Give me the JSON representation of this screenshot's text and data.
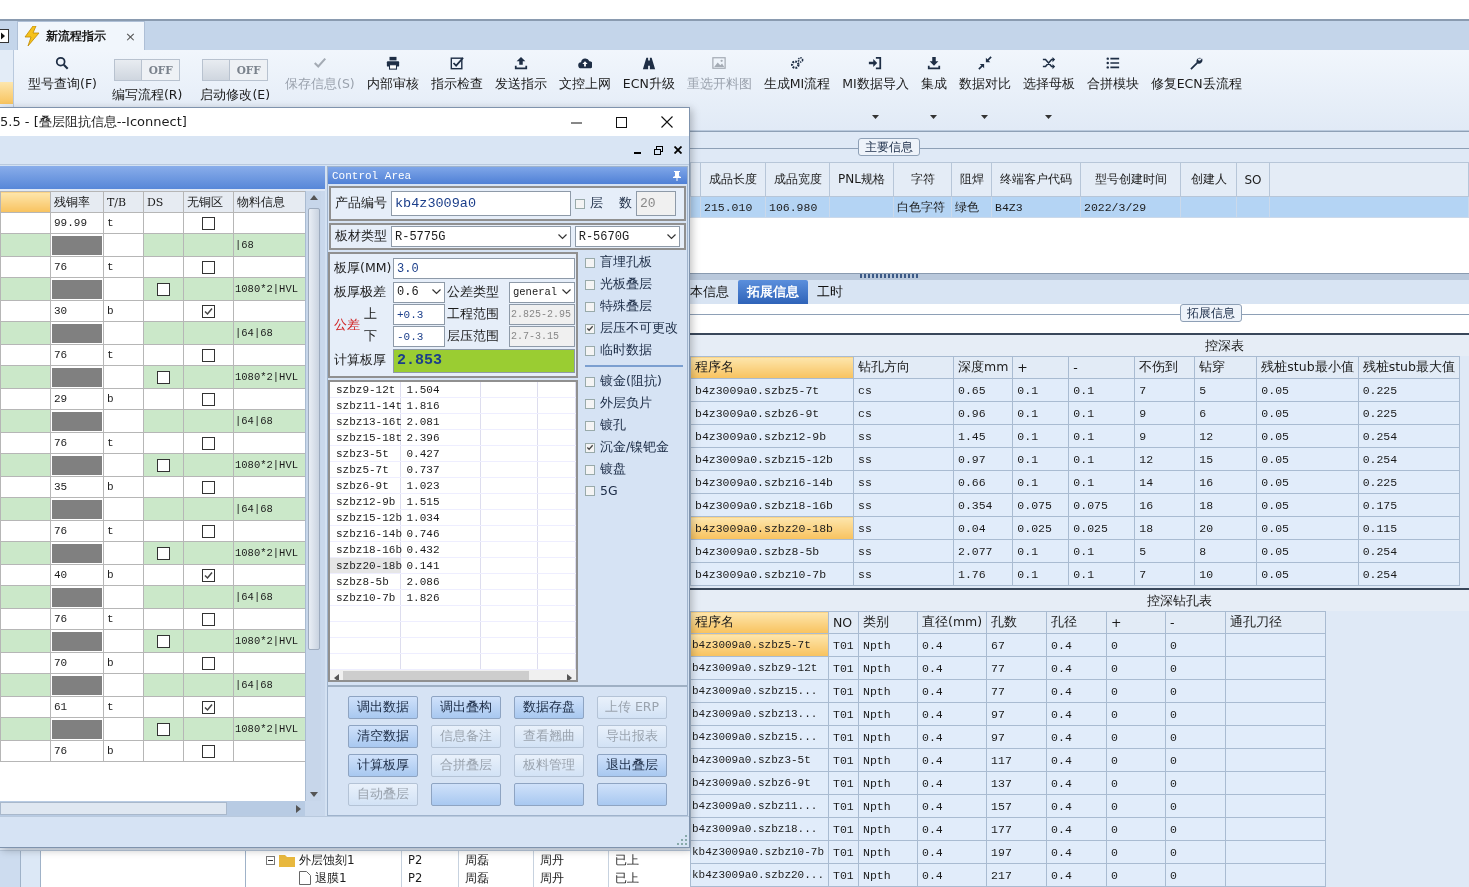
{
  "app": {
    "tab": {
      "title": "新流程指示",
      "close": "×"
    },
    "ribbon": [
      {
        "kind": "button",
        "label": "型号查询(F)",
        "disabled": false
      },
      {
        "kind": "toggle",
        "label": "编写流程(R)",
        "state": "OFF",
        "on": false
      },
      {
        "kind": "toggle",
        "label": "启动修改(E)",
        "state": "OFF",
        "on": false
      },
      {
        "kind": "button",
        "label": "保存信息(S)",
        "disabled": true
      },
      {
        "kind": "button",
        "label": "内部审核",
        "disabled": false
      },
      {
        "kind": "button",
        "label": "指示检查",
        "disabled": false
      },
      {
        "kind": "button",
        "label": "发送指示",
        "disabled": false
      },
      {
        "kind": "button",
        "label": "文控上网",
        "disabled": false
      },
      {
        "kind": "button",
        "label": "ECN升级",
        "disabled": false
      },
      {
        "kind": "button",
        "label": "重选开料图",
        "disabled": true
      },
      {
        "kind": "button",
        "label": "生成MI流程",
        "disabled": false
      },
      {
        "kind": "button",
        "label": "MI数据导入",
        "disabled": false,
        "has_menu": true
      },
      {
        "kind": "button",
        "label": "集成",
        "disabled": false,
        "has_menu": true
      },
      {
        "kind": "button",
        "label": "数据对比",
        "disabled": false,
        "has_menu": true
      },
      {
        "kind": "button",
        "label": "选择母板",
        "disabled": false,
        "has_menu": true
      },
      {
        "kind": "button",
        "label": "合拼模块",
        "disabled": false
      },
      {
        "kind": "button",
        "label": "修复ECN丢流程",
        "disabled": false
      }
    ],
    "main_info": {
      "group": "主要信息",
      "columns": [
        "成品长度",
        "成品宽度",
        "PNL规格",
        "字符",
        "阻焊",
        "终端客户代码",
        "型号创建时间",
        "创建人",
        "SO"
      ],
      "rows": [
        {
          "selected": true,
          "cells": [
            "215.010",
            "106.980",
            null,
            "白色字符",
            "绿色",
            "B4Z3",
            "2022/3/29",
            null,
            null
          ]
        }
      ]
    },
    "detail_tabs": [
      {
        "label": "本信息",
        "selected": false
      },
      {
        "label": "拓展信息",
        "selected": true
      },
      {
        "label": "工时",
        "selected": false
      }
    ],
    "detail_group": "拓展信息",
    "depth_table": {
      "title": "控深表",
      "columns": [
        "程序名",
        "钻孔方向",
        "深度mm",
        "+",
        "-",
        "不伤到",
        "钻穿",
        "残桩stub最小值",
        "残桩stub最大值"
      ],
      "rows": [
        {
          "selected": false,
          "cells": [
            "b4z3009a0.szbz5-7t",
            "cs",
            "0.65",
            "0.1",
            "0.1",
            "7",
            "5",
            "0.05",
            "0.225"
          ]
        },
        {
          "selected": false,
          "cells": [
            "b4z3009a0.szbz6-9t",
            "cs",
            "0.96",
            "0.1",
            "0.1",
            "9",
            "6",
            "0.05",
            "0.225"
          ]
        },
        {
          "selected": false,
          "cells": [
            "b4z3009a0.szbz12-9b",
            "ss",
            "1.45",
            "0.1",
            "0.1",
            "9",
            "12",
            "0.05",
            "0.254"
          ]
        },
        {
          "selected": false,
          "cells": [
            "b4z3009a0.szbz15-12b",
            "ss",
            "0.97",
            "0.1",
            "0.1",
            "12",
            "15",
            "0.05",
            "0.254"
          ]
        },
        {
          "selected": false,
          "cells": [
            "b4z3009a0.szbz16-14b",
            "ss",
            "0.66",
            "0.1",
            "0.1",
            "14",
            "16",
            "0.05",
            "0.225"
          ]
        },
        {
          "selected": false,
          "cells": [
            "b4z3009a0.szbz18-16b",
            "ss",
            "0.354",
            "0.075",
            "0.075",
            "16",
            "18",
            "0.05",
            "0.175"
          ]
        },
        {
          "selected": true,
          "cells": [
            "b4z3009a0.szbz20-18b",
            "ss",
            "0.04",
            "0.025",
            "0.025",
            "18",
            "20",
            "0.05",
            "0.115"
          ]
        },
        {
          "selected": false,
          "cells": [
            "b4z3009a0.szbz8-5b",
            "ss",
            "2.077",
            "0.1",
            "0.1",
            "5",
            "8",
            "0.05",
            "0.254"
          ]
        },
        {
          "selected": false,
          "cells": [
            "b4z3009a0.szbz10-7b",
            "ss",
            "1.76",
            "0.1",
            "0.1",
            "7",
            "10",
            "0.05",
            "0.254"
          ]
        }
      ]
    },
    "drill_table": {
      "title": "控深钻孔表",
      "columns": [
        "程序名",
        "NO",
        "类别",
        "直径(mm)",
        "孔数",
        "孔径",
        "+",
        "-",
        "通孔刀径"
      ],
      "rows": [
        {
          "selected": true,
          "cells": [
            "b4z3009a0.szbz5-7t",
            "T01",
            "Npth",
            "0.4",
            "67",
            "0.4",
            "0",
            "0",
            null
          ]
        },
        {
          "selected": false,
          "cells": [
            "b4z3009a0.szbz9-12t",
            "T01",
            "Npth",
            "0.4",
            "77",
            "0.4",
            "0",
            "0",
            null
          ]
        },
        {
          "selected": false,
          "cells": [
            "b4z3009a0.szbz15...",
            "T01",
            "Npth",
            "0.4",
            "77",
            "0.4",
            "0",
            "0",
            null
          ]
        },
        {
          "selected": false,
          "cells": [
            "b4z3009a0.szbz13...",
            "T01",
            "Npth",
            "0.4",
            "97",
            "0.4",
            "0",
            "0",
            null
          ]
        },
        {
          "selected": false,
          "cells": [
            "b4z3009a0.szbz15...",
            "T01",
            "Npth",
            "0.4",
            "97",
            "0.4",
            "0",
            "0",
            null
          ]
        },
        {
          "selected": false,
          "cells": [
            "b4z3009a0.szbz3-5t",
            "T01",
            "Npth",
            "0.4",
            "117",
            "0.4",
            "0",
            "0",
            null
          ]
        },
        {
          "selected": false,
          "cells": [
            "b4z3009a0.szbz6-9t",
            "T01",
            "Npth",
            "0.4",
            "137",
            "0.4",
            "0",
            "0",
            null
          ]
        },
        {
          "selected": false,
          "cells": [
            "b4z3009a0.szbz11...",
            "T01",
            "Npth",
            "0.4",
            "157",
            "0.4",
            "0",
            "0",
            null
          ]
        },
        {
          "selected": false,
          "cells": [
            "b4z3009a0.szbz18...",
            "T01",
            "Npth",
            "0.4",
            "177",
            "0.4",
            "0",
            "0",
            null
          ]
        },
        {
          "selected": false,
          "cells": [
            "kb4z3009a0.szbz10-7b",
            "T01",
            "Npth",
            "0.4",
            "197",
            "0.4",
            "0",
            "0",
            null
          ]
        },
        {
          "selected": false,
          "cells": [
            "kb4z3009a0.szbz20...",
            "T01",
            "Npth",
            "0.4",
            "217",
            "0.4",
            "0",
            "0",
            null
          ]
        }
      ]
    },
    "tree": [
      {
        "kind": "folder",
        "expanded": true,
        "name": "外层蚀刻1",
        "cells": [
          "P2",
          "周磊",
          "周丹",
          "已上"
        ]
      },
      {
        "kind": "file",
        "name": "退膜1",
        "cells": [
          "P2",
          "周磊",
          "周丹",
          "已上"
        ]
      }
    ]
  },
  "dialog": {
    "title": "5.5 - [叠层阻抗信息--Iconnect]",
    "stack_grid": {
      "columns": [
        "残铜率",
        "T/B",
        "DS",
        "无铜区",
        "物料信息"
      ],
      "rows": [
        {
          "kind": "copper",
          "residual": "99.99",
          "tb": "t",
          "no_copper": false
        },
        {
          "kind": "prepreg",
          "material": "|68"
        },
        {
          "kind": "copper",
          "residual": "76",
          "tb": "t",
          "no_copper": false
        },
        {
          "kind": "prepreg",
          "ds": false,
          "material": "1080*2|HVL"
        },
        {
          "kind": "copper",
          "residual": "30",
          "tb": "b",
          "no_copper": true
        },
        {
          "kind": "prepreg",
          "material": "|64|68"
        },
        {
          "kind": "copper",
          "residual": "76",
          "tb": "t",
          "no_copper": false
        },
        {
          "kind": "prepreg",
          "ds": false,
          "material": "1080*2|HVL"
        },
        {
          "kind": "copper",
          "residual": "29",
          "tb": "b",
          "no_copper": false
        },
        {
          "kind": "prepreg",
          "material": "|64|68"
        },
        {
          "kind": "copper",
          "residual": "76",
          "tb": "t",
          "no_copper": false
        },
        {
          "kind": "prepreg",
          "ds": false,
          "material": "1080*2|HVL"
        },
        {
          "kind": "copper",
          "residual": "35",
          "tb": "b",
          "no_copper": false
        },
        {
          "kind": "prepreg",
          "material": "|64|68"
        },
        {
          "kind": "copper",
          "residual": "76",
          "tb": "t",
          "no_copper": false
        },
        {
          "kind": "prepreg",
          "ds": false,
          "material": "1080*2|HVL"
        },
        {
          "kind": "copper",
          "residual": "40",
          "tb": "b",
          "no_copper": true
        },
        {
          "kind": "prepreg",
          "material": "|64|68"
        },
        {
          "kind": "copper",
          "residual": "76",
          "tb": "t",
          "no_copper": false
        },
        {
          "kind": "prepreg",
          "ds": false,
          "material": "1080*2|HVL"
        },
        {
          "kind": "copper",
          "residual": "70",
          "tb": "b",
          "no_copper": false
        },
        {
          "kind": "prepreg",
          "material": "|64|68"
        },
        {
          "kind": "copper",
          "residual": "61",
          "tb": "t",
          "no_copper": true
        },
        {
          "kind": "prepreg",
          "ds": false,
          "material": "1080*2|HVL"
        },
        {
          "kind": "copper",
          "residual": "76",
          "tb": "b",
          "no_copper": false
        }
      ]
    },
    "control_area": {
      "title": "Control Area",
      "product": {
        "label": "产品编号",
        "value": "kb4z3009a0"
      },
      "layers": {
        "label": "层 数",
        "checked": false,
        "value": "20"
      },
      "material": {
        "label": "板材类型",
        "core": "R-5775G",
        "prepreg": "R-5670G"
      },
      "thickness": {
        "label": "板厚(MM)",
        "value": "3.0"
      },
      "range": {
        "label": "板厚极差",
        "value": "0.6"
      },
      "tolerance_type": {
        "label": "公差类型",
        "value": "general"
      },
      "tolerance": {
        "label": "公差",
        "upper_label": "上",
        "upper": "+0.3",
        "lower_label": "下",
        "lower": "-0.3"
      },
      "eng_range": {
        "label": "工程范围",
        "value": "2.825-2.95"
      },
      "press_range": {
        "label": "层压范围",
        "value": "2.7-3.15"
      },
      "calc": {
        "label": "计算板厚",
        "value": "2.853"
      },
      "options": [
        {
          "label": "盲埋孔板",
          "checked": false
        },
        {
          "label": "光板叠层",
          "checked": false
        },
        {
          "label": "特殊叠层",
          "checked": false
        },
        {
          "label": "层压不可更改",
          "checked": true
        },
        {
          "label": "临时数据",
          "checked": false
        }
      ],
      "options_2": [
        {
          "label": "镀金(阻抗)",
          "checked": false
        },
        {
          "label": "外层负片",
          "checked": false
        },
        {
          "label": "镀孔",
          "checked": false
        },
        {
          "label": "沉金/镍钯金",
          "checked": true
        },
        {
          "label": "镀盘",
          "checked": false
        },
        {
          "label": "5G",
          "checked": false
        }
      ],
      "layer_list": [
        {
          "name": "szbz9-12t",
          "value": "1.504",
          "selected": false
        },
        {
          "name": "szbz11-14t",
          "value": "1.816",
          "selected": false
        },
        {
          "name": "szbz13-16t",
          "value": "2.081",
          "selected": false
        },
        {
          "name": "szbz15-18t",
          "value": "2.396",
          "selected": false
        },
        {
          "name": "szbz3-5t",
          "value": "0.427",
          "selected": false
        },
        {
          "name": "szbz5-7t",
          "value": "0.737",
          "selected": false
        },
        {
          "name": "szbz6-9t",
          "value": "1.023",
          "selected": false
        },
        {
          "name": "szbz12-9b",
          "value": "1.515",
          "selected": false
        },
        {
          "name": "szbz15-12b",
          "value": "1.034",
          "selected": false
        },
        {
          "name": "szbz16-14b",
          "value": "0.746",
          "selected": false
        },
        {
          "name": "szbz18-16b",
          "value": "0.432",
          "selected": false
        },
        {
          "name": "szbz20-18b",
          "value": "0.141",
          "selected": true
        },
        {
          "name": "szbz8-5b",
          "value": "2.086",
          "selected": false
        },
        {
          "name": "szbz10-7b",
          "value": "1.826",
          "selected": false
        }
      ],
      "buttons": [
        {
          "label": "调出数据",
          "disabled": false
        },
        {
          "label": "调出叠构",
          "disabled": false
        },
        {
          "label": "数据存盘",
          "disabled": false
        },
        {
          "label": "上传 ERP",
          "disabled": true
        },
        {
          "label": "清空数据",
          "disabled": false
        },
        {
          "label": "信息备注",
          "disabled": true
        },
        {
          "label": "查看翘曲",
          "disabled": true
        },
        {
          "label": "导出报表",
          "disabled": true
        },
        {
          "label": "计算板厚",
          "disabled": false
        },
        {
          "label": "合拼叠层",
          "disabled": true
        },
        {
          "label": "板料管理",
          "disabled": true
        },
        {
          "label": "退出叠层",
          "disabled": false
        },
        {
          "label": "自动叠层",
          "disabled": true
        },
        {
          "disabled": false
        },
        {
          "disabled": false
        },
        {
          "disabled": false
        }
      ]
    }
  }
}
